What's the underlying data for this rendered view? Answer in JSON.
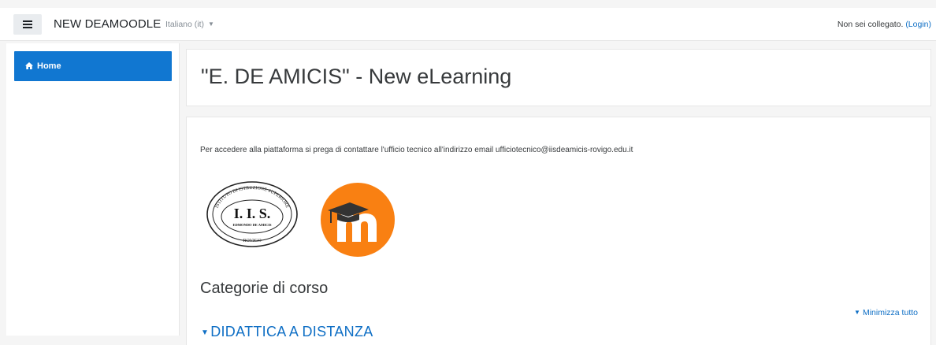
{
  "navbar": {
    "menu_icon": "hamburger-icon",
    "brand": "NEW DEAMOODLE",
    "language": "Italiano (it)",
    "language_caret": "caret-down-icon",
    "login_status": "Non sei collegato.",
    "login_link": "(Login)"
  },
  "drawer": {
    "items": [
      {
        "icon": "home-icon",
        "label": "Home",
        "active": true
      }
    ]
  },
  "header": {
    "title": "\"E. DE AMICIS\" - New eLearning"
  },
  "main": {
    "intro": "Per accedere alla piattaforma si prega di contattare l'ufficio tecnico all'indirizzo email ufficiotecnico@iisdeamicis-rovigo.edu.it",
    "logos": {
      "iis": {
        "ring_text": "ISTITUTO DI ISTRUZIONE SUPERIORE",
        "main_text": "I. I. S.",
        "sub_text": "EDMONDO DE AMICIS",
        "bottom_text": "ROVIGO"
      },
      "moodle": {
        "icon": "moodle-logo-icon"
      }
    },
    "categories_title": "Categorie di corso",
    "collapse_all": "Minimizza tutto",
    "categories": [
      {
        "label": "DIDATTICA A DISTANZA",
        "expanded": true
      }
    ]
  },
  "colors": {
    "primary": "#1177d1",
    "link": "#0f6fc5",
    "moodle_orange": "#f98012",
    "background": "#f5f5f5"
  }
}
